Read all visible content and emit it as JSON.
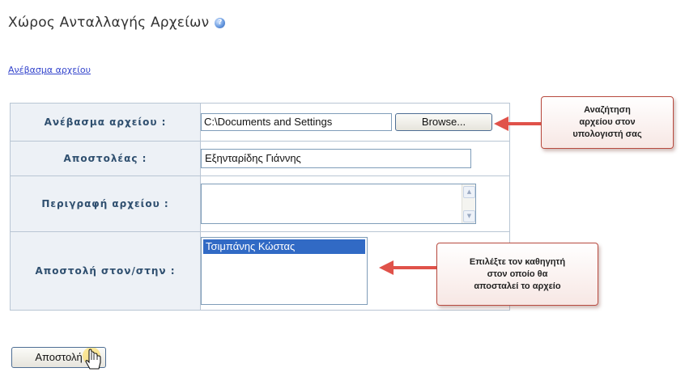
{
  "header": {
    "title": "Χώρος Ανταλλαγής Αρχείων",
    "help_icon": "help-icon"
  },
  "upload_link": "Ανέβασμα αρχείου",
  "form": {
    "file": {
      "label": "Ανέβασμα αρχείου :",
      "value": "C:\\Documents and Settings",
      "browse_label": "Browse..."
    },
    "sender": {
      "label": "Αποστολέας :",
      "value": "Εξηνταρίδης Γιάννης"
    },
    "description": {
      "label": "Περιγραφή αρχείου :",
      "value": ""
    },
    "recipient": {
      "label": "Αποστολή στον/στην :",
      "options": [
        "Τσιμπάνης Κώστας"
      ],
      "selected": "Τσιμπάνης Κώστας"
    }
  },
  "callouts": {
    "browse": [
      "Αναζήτηση",
      "αρχείου στον",
      "υπολογιστή σας"
    ],
    "recipient": [
      "Επιλέξτε τον καθηγητή",
      "στον οποίο θα",
      "αποσταλεί το αρχείο"
    ]
  },
  "submit_label": "Αποστολή",
  "colors": {
    "label_bg": "#edf1f6",
    "label_text": "#2f4f6f",
    "border": "#b9c6d4",
    "link": "#3344cc",
    "selection": "#316ac5",
    "callout_border": "#b84a3f",
    "arrow": "#e0524a"
  }
}
